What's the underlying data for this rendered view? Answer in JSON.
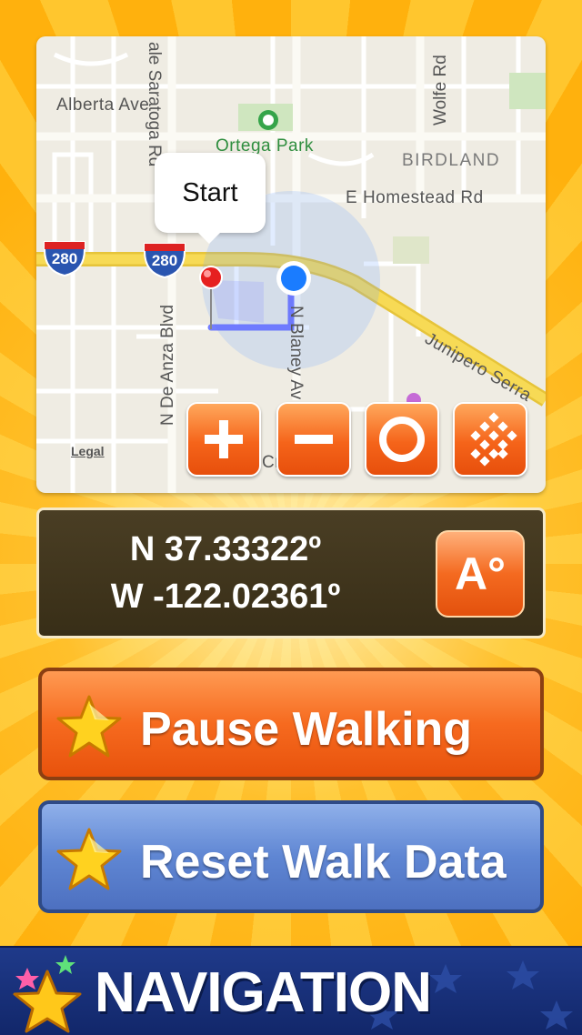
{
  "map": {
    "labels": {
      "alberta_ave": "Alberta Ave",
      "saratoga": "ale Saratoga Rd",
      "ortega_park": "Ortega Park",
      "wolfe": "Wolfe Rd",
      "birdland": "BIRDLAND",
      "homestead": "E Homestead Rd",
      "de_anza": "N De Anza Blvd",
      "blaney": "N Blaney Av",
      "junipero": "Junipero Serra",
      "cr": "Cr"
    },
    "shield_label": "280",
    "legal_label": "Legal",
    "callout_label": "Start",
    "controls": {
      "zoom_in": "zoom-in",
      "zoom_out": "zoom-out",
      "center": "center",
      "map_type": "map-type"
    },
    "colors": {
      "route": "#4d5bff",
      "location_dot": "#1a7cff",
      "pin": "#e21c1c",
      "highway": "#f5d34a"
    }
  },
  "coordinates": {
    "lat": "N 37.33322º",
    "lon": "W -122.02361º",
    "format_button_label": "A°"
  },
  "buttons": {
    "pause_label": "Pause Walking",
    "reset_label": "Reset Walk Data"
  },
  "footer": {
    "title": "NAVIGATION"
  }
}
